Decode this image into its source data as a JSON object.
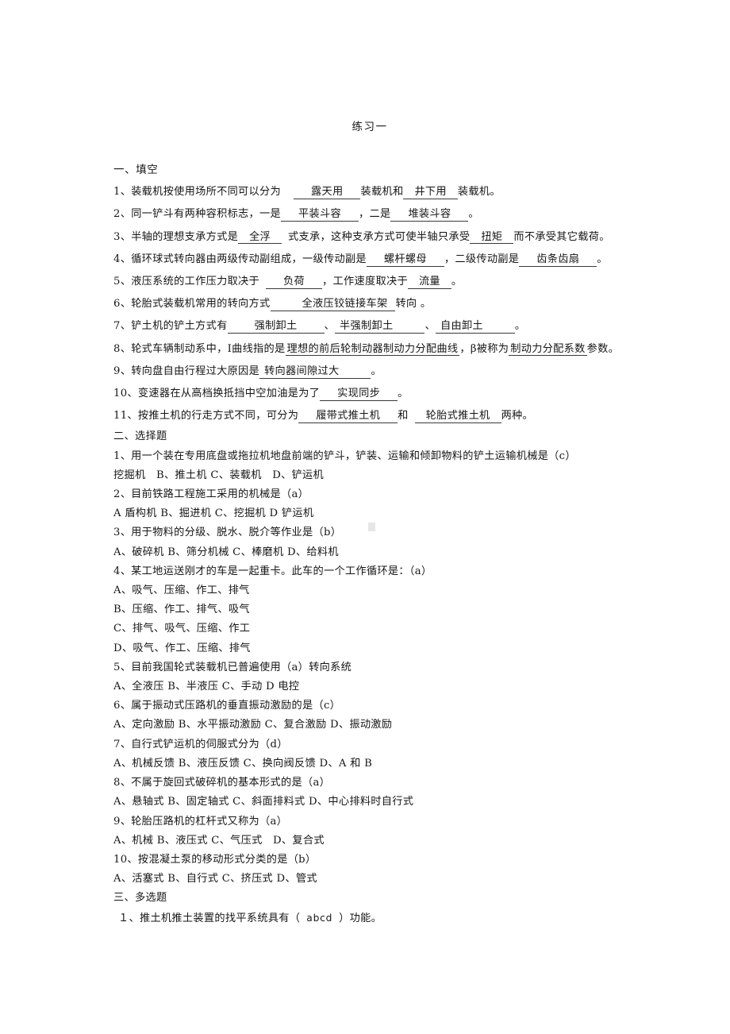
{
  "document": {
    "title": "练习一"
  },
  "sections": {
    "fill_in": {
      "heading": "一、填空",
      "questions": [
        {
          "number": "1、",
          "parts": [
            {
              "t": "text",
              "v": "装载机按使用场所不同可以分为"
            },
            {
              "t": "blank",
              "v": "露天用"
            },
            {
              "t": "text",
              "v": "装载机和"
            },
            {
              "t": "blank",
              "v": "井下用"
            },
            {
              "t": "text",
              "v": "装载机。"
            }
          ]
        },
        {
          "number": "2、",
          "parts": [
            {
              "t": "text",
              "v": "同一铲斗有两种容积标志，一是"
            },
            {
              "t": "blank",
              "v": "平装斗容"
            },
            {
              "t": "text",
              "v": "，二是"
            },
            {
              "t": "blank",
              "v": "堆装斗容"
            },
            {
              "t": "text",
              "v": "。"
            }
          ]
        },
        {
          "number": "3、",
          "parts": [
            {
              "t": "text",
              "v": "半轴的理想支承方式是"
            },
            {
              "t": "blank",
              "v": "全浮"
            },
            {
              "t": "text",
              "v": "式支承，这种支承方式可使半轴只承受"
            },
            {
              "t": "blank",
              "v": "扭矩"
            },
            {
              "t": "text",
              "v": "而不承受其它载荷。"
            }
          ]
        },
        {
          "number": "4、",
          "parts": [
            {
              "t": "text",
              "v": "循环球式转向器由两级传动副组成，一级传动副是"
            },
            {
              "t": "blank",
              "v": "螺杆螺母"
            },
            {
              "t": "text",
              "v": "，二级传动副是"
            },
            {
              "t": "blank",
              "v": "齿条齿扇"
            },
            {
              "t": "text",
              "v": "。"
            }
          ]
        },
        {
          "number": "5、",
          "parts": [
            {
              "t": "text",
              "v": "液压系统的工作压力取决于"
            },
            {
              "t": "blank",
              "v": "负荷"
            },
            {
              "t": "text",
              "v": "，工作速度取决于"
            },
            {
              "t": "blank",
              "v": "流量"
            },
            {
              "t": "text",
              "v": "。"
            }
          ]
        },
        {
          "number": "6、",
          "parts": [
            {
              "t": "text",
              "v": "轮胎式装载机常用的转向方式"
            },
            {
              "t": "blank",
              "v": "全液压铰链接车架"
            },
            {
              "t": "text",
              "v": "转向 。"
            }
          ]
        },
        {
          "number": "7、",
          "parts": [
            {
              "t": "text",
              "v": "铲土机的铲土方式有"
            },
            {
              "t": "blank",
              "v": "强制卸土"
            },
            {
              "t": "text",
              "v": "、"
            },
            {
              "t": "blank",
              "v": "半强制卸土"
            },
            {
              "t": "text",
              "v": "、"
            },
            {
              "t": "blank",
              "v": "自由卸土"
            },
            {
              "t": "text",
              "v": "。"
            }
          ]
        },
        {
          "number": "8、",
          "parts": [
            {
              "t": "text",
              "v": "轮式车辆制动系中，Ⅰ曲线指的是"
            },
            {
              "t": "blank",
              "v": "理想的前后轮制动器制动力分配曲线"
            },
            {
              "t": "text",
              "v": "，β被称为"
            },
            {
              "t": "blank",
              "v": "制动力分配系数"
            },
            {
              "t": "text",
              "v": "参数。"
            }
          ]
        },
        {
          "number": "9、",
          "parts": [
            {
              "t": "text",
              "v": "转向盘自由行程过大原因是"
            },
            {
              "t": "blank",
              "v": "转向器间隙过大"
            },
            {
              "t": "text",
              "v": "。"
            }
          ]
        },
        {
          "number": "10、",
          "parts": [
            {
              "t": "text",
              "v": "变速器在从高档换抵挡中空加油是为了"
            },
            {
              "t": "blank",
              "v": "实现同步"
            },
            {
              "t": "text",
              "v": "。"
            }
          ]
        },
        {
          "number": "11、",
          "parts": [
            {
              "t": "text",
              "v": "按推土机的行走方式不同，可分为"
            },
            {
              "t": "blank",
              "v": "履带式推土机"
            },
            {
              "t": "text",
              "v": "和"
            },
            {
              "t": "blank",
              "v": "轮胎式推土机"
            },
            {
              "t": "text",
              "v": "两种。"
            }
          ]
        }
      ]
    },
    "choice": {
      "heading": "二、选择题",
      "questions": [
        {
          "stem": "1、用一个装在专用底盘或拖拉机地盘前端的铲斗，铲装、运输和倾卸物料的铲土运输机械是（c）",
          "options": [
            "挖掘机　B、推土机 C、装载机　D、铲运机"
          ]
        },
        {
          "stem": "2、目前铁路工程施工采用的机械是（a）",
          "options": [
            "A 盾构机 B、掘进机 C、挖掘机 D 铲运机"
          ]
        },
        {
          "stem": "3、用于物料的分级、脱水、脱介等作业是（b）",
          "options": [
            "A、破碎机 B、筛分机械 C、棒磨机 D、给料机"
          ]
        },
        {
          "stem": "4、某工地运送刚才的车是一起重卡。此车的一个工作循环是：（a）",
          "options": [
            "A、吸气、压缩、作工、排气",
            "B、压缩、作工、排气、吸气",
            "C、排气、吸气、压缩、作工",
            "D、吸气、作工、压缩、排气"
          ]
        },
        {
          "stem": "5、目前我国轮式装载机已普遍使用（a）转向系统",
          "options": [
            "A、全液压 B、半液压 C、手动 D 电控"
          ]
        },
        {
          "stem": "6、属于振动式压路机的垂直振动激励的是（c）",
          "options": [
            "A、定向激励 B、水平振动激励 C、复合激励 D、振动激励"
          ]
        },
        {
          "stem": "7、自行式铲运机的伺服式分为（d）",
          "options": [
            "A、机械反馈 B、液压反馈 C、换向阀反馈 D、A 和 B"
          ]
        },
        {
          "stem": "8、不属于旋回式破碎机的基本形式的是（a）",
          "options": [
            "A、悬轴式 B、固定轴式 C、斜面排料式 D、中心排料时自行式"
          ]
        },
        {
          "stem": "9、轮胎压路机的杠杆式又称为（a）",
          "options": [
            "A、机械 B、液压式 C、气压式　D、复合式"
          ]
        },
        {
          "stem": "10、按混凝土泵的移动形式分类的是（b）",
          "options": [
            "A、活塞式 B、自行式 C、挤压式 D、管式"
          ]
        }
      ]
    },
    "multi_choice": {
      "heading": "三、多选题",
      "questions": [
        {
          "prefix": "１、推土机推土装置的找平系统具有（",
          "answer": "abcd",
          "suffix": "）功能。"
        }
      ]
    }
  }
}
